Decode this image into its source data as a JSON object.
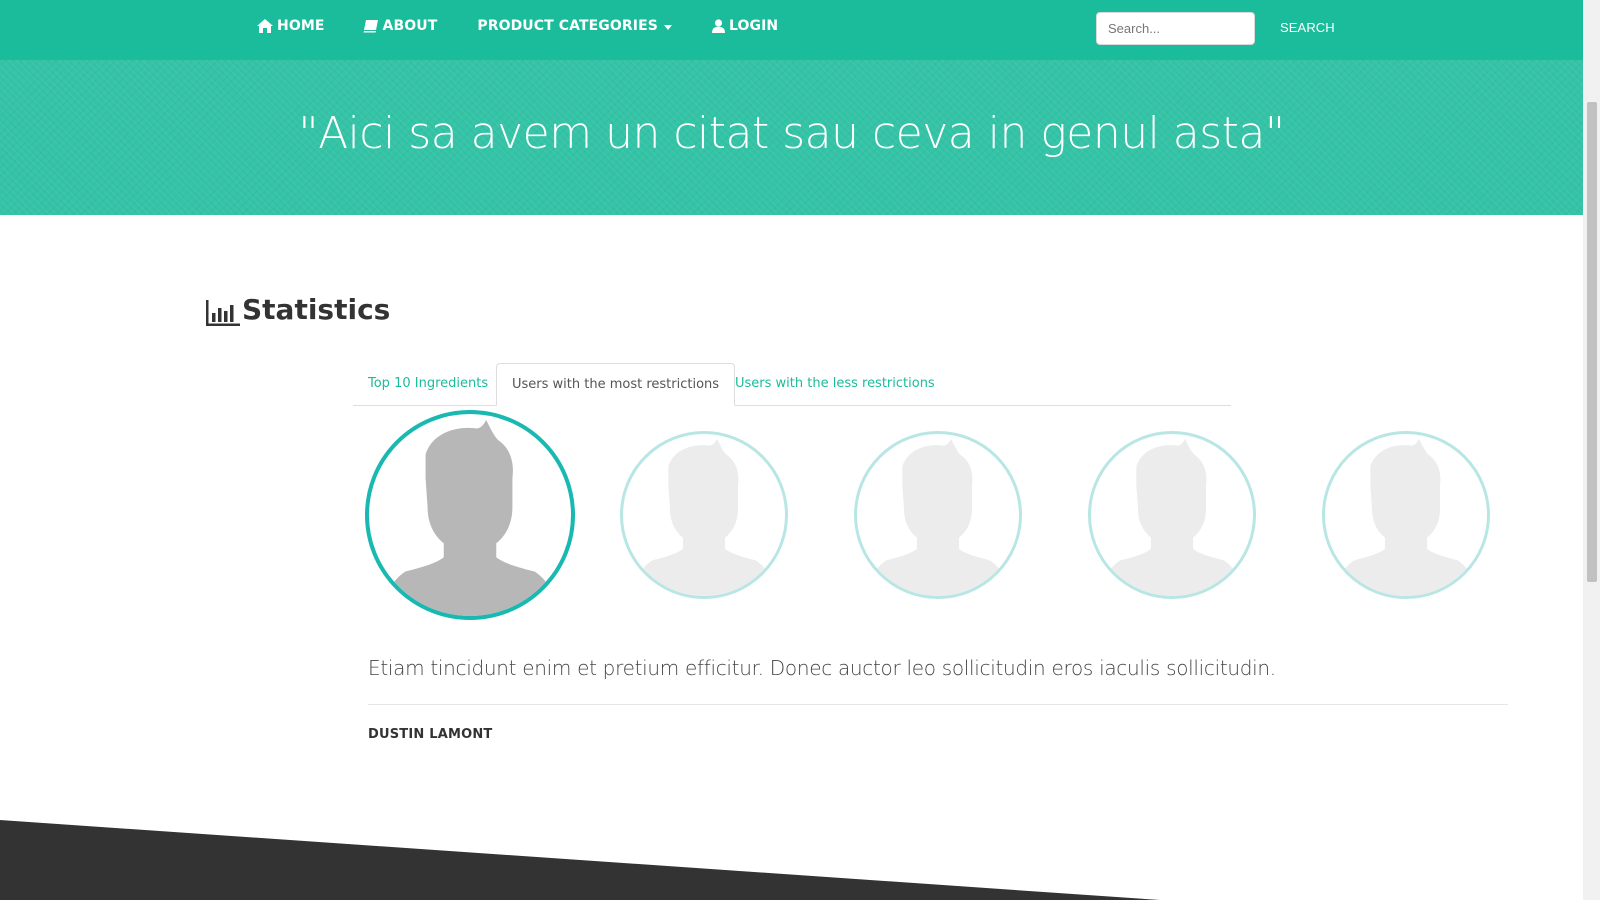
{
  "nav": {
    "home": "HOME",
    "about": "ABOUT",
    "categories": "PRODUCT CATEGORIES",
    "login": "LOGIN",
    "search_placeholder": "Search...",
    "search_button": "SEARCH",
    "icons": [
      "home-icon",
      "book-icon",
      "chevron-down-icon",
      "user-icon"
    ]
  },
  "hero": {
    "quote": "\"Aici sa avem un citat sau ceva in genul asta\""
  },
  "stats": {
    "title": "Statistics",
    "icon": "bar-chart-icon"
  },
  "tabs": [
    {
      "label": "Top 10 Ingredients"
    },
    {
      "label": "Users with the most restrictions",
      "active": true
    },
    {
      "label": "Users with the less restrictions"
    }
  ],
  "testimonial": {
    "text": "Etiam tincidunt enim et pretium efficitur. Donec auctor leo sollicitudin eros iaculis sollicitudin.",
    "author": "DUSTIN LAMONT"
  },
  "colors": {
    "primary": "#1bbc9b",
    "hero": "#34c3a6",
    "active_ring": "#19b8b0",
    "inactive_ring": "#b8e6e4",
    "footer": "#333333"
  }
}
